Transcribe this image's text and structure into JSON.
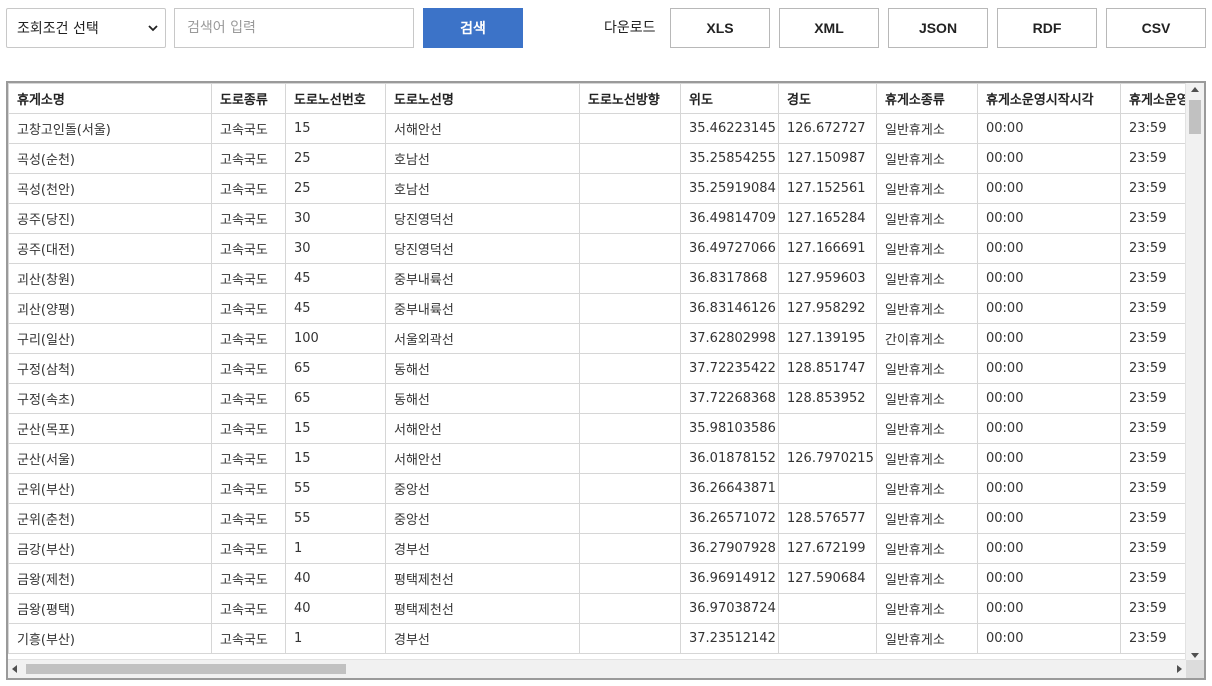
{
  "toolbar": {
    "select_value": "조회조건 선택",
    "search_placeholder": "검색어 입력",
    "search_label": "검색",
    "download_label": "다운로드",
    "download_buttons": [
      "XLS",
      "XML",
      "JSON",
      "RDF",
      "CSV"
    ]
  },
  "table": {
    "headers": [
      "휴게소명",
      "도로종류",
      "도로노선번호",
      "도로노선명",
      "도로노선방향",
      "위도",
      "경도",
      "휴게소종류",
      "휴게소운영시작시각",
      "휴게소운영종료시각"
    ],
    "rows": [
      [
        "고창고인돌(서울)",
        "고속국도",
        "15",
        "서해안선",
        "",
        "35.46223145",
        "126.672727",
        "일반휴게소",
        "00:00",
        "23:59"
      ],
      [
        "곡성(순천)",
        "고속국도",
        "25",
        "호남선",
        "",
        "35.25854255",
        "127.150987",
        "일반휴게소",
        "00:00",
        "23:59"
      ],
      [
        "곡성(천안)",
        "고속국도",
        "25",
        "호남선",
        "",
        "35.25919084",
        "127.152561",
        "일반휴게소",
        "00:00",
        "23:59"
      ],
      [
        "공주(당진)",
        "고속국도",
        "30",
        "당진영덕선",
        "",
        "36.49814709",
        "127.165284",
        "일반휴게소",
        "00:00",
        "23:59"
      ],
      [
        "공주(대전)",
        "고속국도",
        "30",
        "당진영덕선",
        "",
        "36.49727066",
        "127.166691",
        "일반휴게소",
        "00:00",
        "23:59"
      ],
      [
        "괴산(창원)",
        "고속국도",
        "45",
        "중부내륙선",
        "",
        "36.8317868",
        "127.959603",
        "일반휴게소",
        "00:00",
        "23:59"
      ],
      [
        "괴산(양평)",
        "고속국도",
        "45",
        "중부내륙선",
        "",
        "36.83146126",
        "127.958292",
        "일반휴게소",
        "00:00",
        "23:59"
      ],
      [
        "구리(일산)",
        "고속국도",
        "100",
        "서울외곽선",
        "",
        "37.62802998",
        "127.139195",
        "간이휴게소",
        "00:00",
        "23:59"
      ],
      [
        "구정(삼척)",
        "고속국도",
        "65",
        "동해선",
        "",
        "37.72235422",
        "128.851747",
        "일반휴게소",
        "00:00",
        "23:59"
      ],
      [
        "구정(속초)",
        "고속국도",
        "65",
        "동해선",
        "",
        "37.72268368",
        "128.853952",
        "일반휴게소",
        "00:00",
        "23:59"
      ],
      [
        "군산(목포)",
        "고속국도",
        "15",
        "서해안선",
        "",
        "35.98103586",
        "",
        "일반휴게소",
        "00:00",
        "23:59"
      ],
      [
        "군산(서울)",
        "고속국도",
        "15",
        "서해안선",
        "",
        "36.01878152",
        "126.7970215",
        "일반휴게소",
        "00:00",
        "23:59"
      ],
      [
        "군위(부산)",
        "고속국도",
        "55",
        "중앙선",
        "",
        "36.26643871",
        "",
        "일반휴게소",
        "00:00",
        "23:59"
      ],
      [
        "군위(춘천)",
        "고속국도",
        "55",
        "중앙선",
        "",
        "36.26571072",
        "128.576577",
        "일반휴게소",
        "00:00",
        "23:59"
      ],
      [
        "금강(부산)",
        "고속국도",
        "1",
        "경부선",
        "",
        "36.27907928",
        "127.672199",
        "일반휴게소",
        "00:00",
        "23:59"
      ],
      [
        "금왕(제천)",
        "고속국도",
        "40",
        "평택제천선",
        "",
        "36.96914912",
        "127.590684",
        "일반휴게소",
        "00:00",
        "23:59"
      ],
      [
        "금왕(평택)",
        "고속국도",
        "40",
        "평택제천선",
        "",
        "36.97038724",
        "",
        "일반휴게소",
        "00:00",
        "23:59"
      ],
      [
        "기흥(부산)",
        "고속국도",
        "1",
        "경부선",
        "",
        "37.23512142",
        "",
        "일반휴게소",
        "00:00",
        "23:59"
      ]
    ]
  },
  "colors": {
    "accent": "#3c73c8",
    "border": "#9a9a9a"
  },
  "icons": {
    "select_arrow": "chevron-down-icon",
    "scroll_up": "scroll-up-icon",
    "scroll_down": "scroll-down-icon",
    "scroll_left": "scroll-left-icon",
    "scroll_right": "scroll-right-icon"
  }
}
